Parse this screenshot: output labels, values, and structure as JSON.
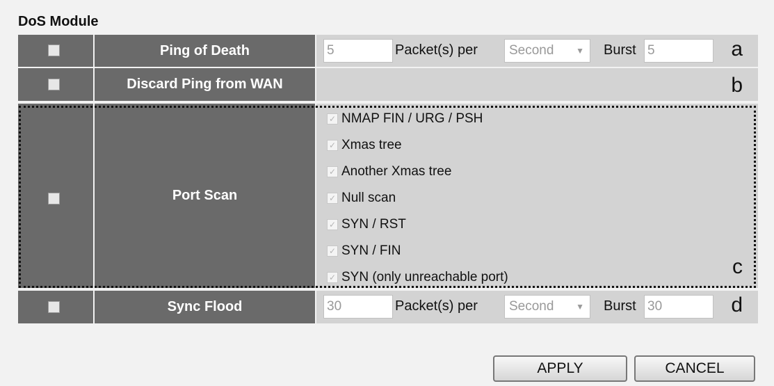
{
  "module_title": "DoS Module",
  "rows": {
    "ping_of_death": {
      "label": "Ping of Death",
      "packets": "5",
      "packets_per_label": "Packet(s) per",
      "unit": "Second",
      "burst_label": "Burst",
      "burst": "5",
      "marker": "a"
    },
    "discard_ping": {
      "label": "Discard Ping from WAN",
      "marker": "b"
    },
    "port_scan": {
      "label": "Port Scan",
      "marker": "c",
      "options": [
        "NMAP FIN / URG / PSH",
        "Xmas tree",
        "Another Xmas tree",
        "Null scan",
        "SYN / RST",
        "SYN / FIN",
        "SYN (only unreachable port)"
      ]
    },
    "sync_flood": {
      "label": "Sync Flood",
      "packets": "30",
      "packets_per_label": "Packet(s) per",
      "unit": "Second",
      "burst_label": "Burst",
      "burst": "30",
      "marker": "d"
    }
  },
  "buttons": {
    "apply": "APPLY",
    "cancel": "CANCEL"
  },
  "colors": {
    "header_cell": "#6a6a6a",
    "value_cell": "#d3d3d3"
  }
}
